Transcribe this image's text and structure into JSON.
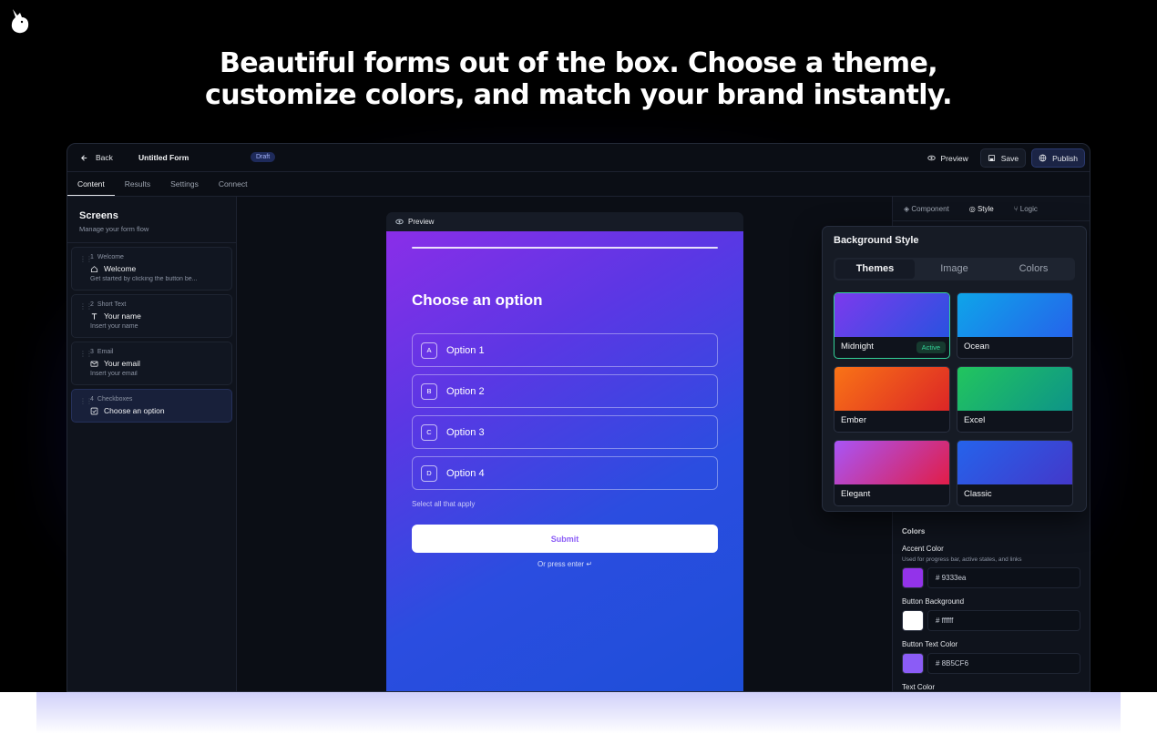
{
  "headline": {
    "line1": "Beautiful forms out of the box. Choose a theme,",
    "line2": "customize colors, and match your brand instantly."
  },
  "topbar": {
    "back_label": "Back",
    "form_title": "Untitled Form",
    "status_badge": "Draft",
    "preview_label": "Preview",
    "save_label": "Save",
    "publish_label": "Publish"
  },
  "tabs": [
    "Content",
    "Results",
    "Settings",
    "Connect"
  ],
  "sidebar": {
    "title": "Screens",
    "subtitle": "Manage your form flow",
    "screens": [
      {
        "num": "1",
        "type": "Welcome",
        "name": "Welcome",
        "desc": "Get started by clicking the button be...",
        "icon": "home-icon"
      },
      {
        "num": "2",
        "type": "Short Text",
        "name": "Your name",
        "desc": "Insert your name",
        "icon": "text-icon"
      },
      {
        "num": "3",
        "type": "Email",
        "name": "Your email",
        "desc": "Insert your email",
        "icon": "mail-icon"
      },
      {
        "num": "4",
        "type": "Checkboxes",
        "name": "Choose an option",
        "desc": "",
        "icon": "checkbox-icon"
      }
    ]
  },
  "preview": {
    "header_label": "Preview",
    "question": "Choose an option",
    "options": [
      {
        "key": "A",
        "label": "Option 1"
      },
      {
        "key": "B",
        "label": "Option 2"
      },
      {
        "key": "C",
        "label": "Option 3"
      },
      {
        "key": "D",
        "label": "Option 4"
      }
    ],
    "hint": "Select all that apply",
    "submit_label": "Submit",
    "enter_hint": "Or press enter ↵"
  },
  "right_panel": {
    "tabs": [
      "Component",
      "Style",
      "Logic"
    ],
    "active_tab": "Style"
  },
  "background_style": {
    "title": "Background Style",
    "segments": [
      "Themes",
      "Image",
      "Colors"
    ],
    "active_segment": "Themes",
    "themes": [
      {
        "name": "Midnight",
        "active": true,
        "badge": "Active",
        "from": "#7c3aed",
        "to": "#2952e0"
      },
      {
        "name": "Ocean",
        "active": false,
        "from": "#0ea5e9",
        "to": "#2563eb"
      },
      {
        "name": "Ember",
        "active": false,
        "from": "#f97316",
        "to": "#dc2626"
      },
      {
        "name": "Excel",
        "active": false,
        "from": "#22c55e",
        "to": "#0d9488"
      },
      {
        "name": "Elegant",
        "active": false,
        "from": "#a855f7",
        "to": "#e11d48"
      },
      {
        "name": "Classic",
        "active": false,
        "from": "#2563eb",
        "to": "#4338ca"
      }
    ]
  },
  "colors": {
    "title": "Colors",
    "accent": {
      "label": "Accent Color",
      "sub": "Used for progress bar, active states, and links",
      "value": "# 9333ea",
      "swatch": "#9333ea"
    },
    "button_bg": {
      "label": "Button Background",
      "value": "# ffffff",
      "swatch": "#ffffff"
    },
    "button_text": {
      "label": "Button Text Color",
      "value": "# 8B5CF6",
      "swatch": "#8b5cf6"
    },
    "text": {
      "label": "Text Color"
    }
  }
}
